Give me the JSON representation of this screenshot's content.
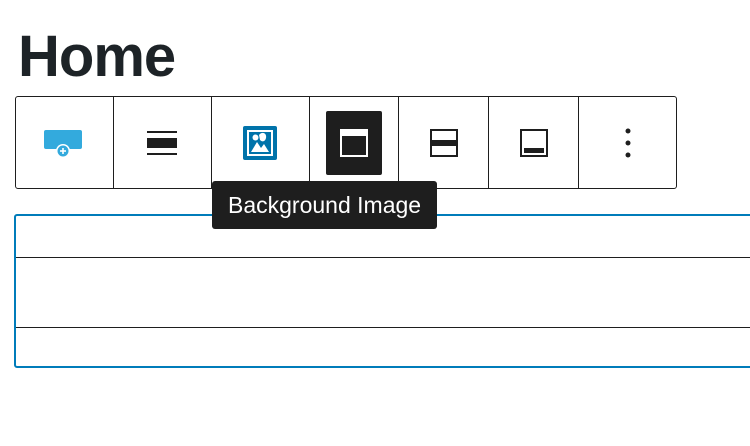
{
  "page": {
    "title": "Home"
  },
  "toolbar": {
    "buttons": [
      {
        "id": "add-media",
        "icon": "image-add-icon"
      },
      {
        "id": "align",
        "icon": "align-center-icon"
      },
      {
        "id": "background-image",
        "icon": "background-image-icon"
      },
      {
        "id": "full-height",
        "icon": "fullscreen-icon",
        "active": true
      },
      {
        "id": "position-center",
        "icon": "position-center-icon"
      },
      {
        "id": "position-bottom",
        "icon": "position-bottom-icon"
      },
      {
        "id": "more-options",
        "icon": "more-vertical-icon"
      }
    ]
  },
  "tooltip": {
    "text": "Background Image"
  },
  "colors": {
    "accent": "#007cba",
    "dark": "#1e1e1e",
    "title": "#1d2327",
    "icon_blue": "#0073aa",
    "icon_light_blue": "#33aadd"
  }
}
